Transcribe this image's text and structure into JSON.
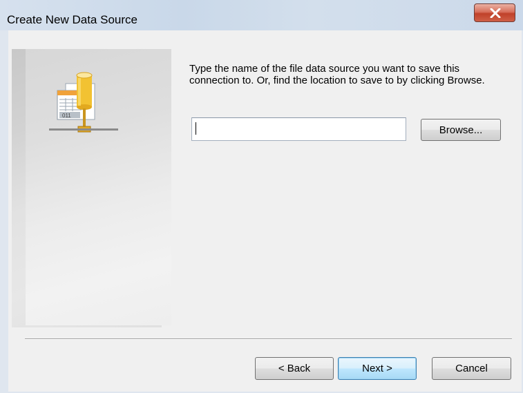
{
  "window": {
    "title": "Create New Data Source"
  },
  "wizard": {
    "illustration_icon": "file-data-source-icon",
    "instruction_text": "Type the name of the file data source you want to save this connection to.  Or, find the location to save to by clicking Browse.",
    "file_name_value": "",
    "file_label_text": "011"
  },
  "buttons": {
    "browse_label": "Browse...",
    "back_label": "< Back",
    "next_label": "Next >",
    "cancel_label": "Cancel"
  },
  "colors": {
    "close_button": "#c7452f",
    "default_button_border": "#3c7fb1",
    "title_bar": "#cfdcea"
  }
}
